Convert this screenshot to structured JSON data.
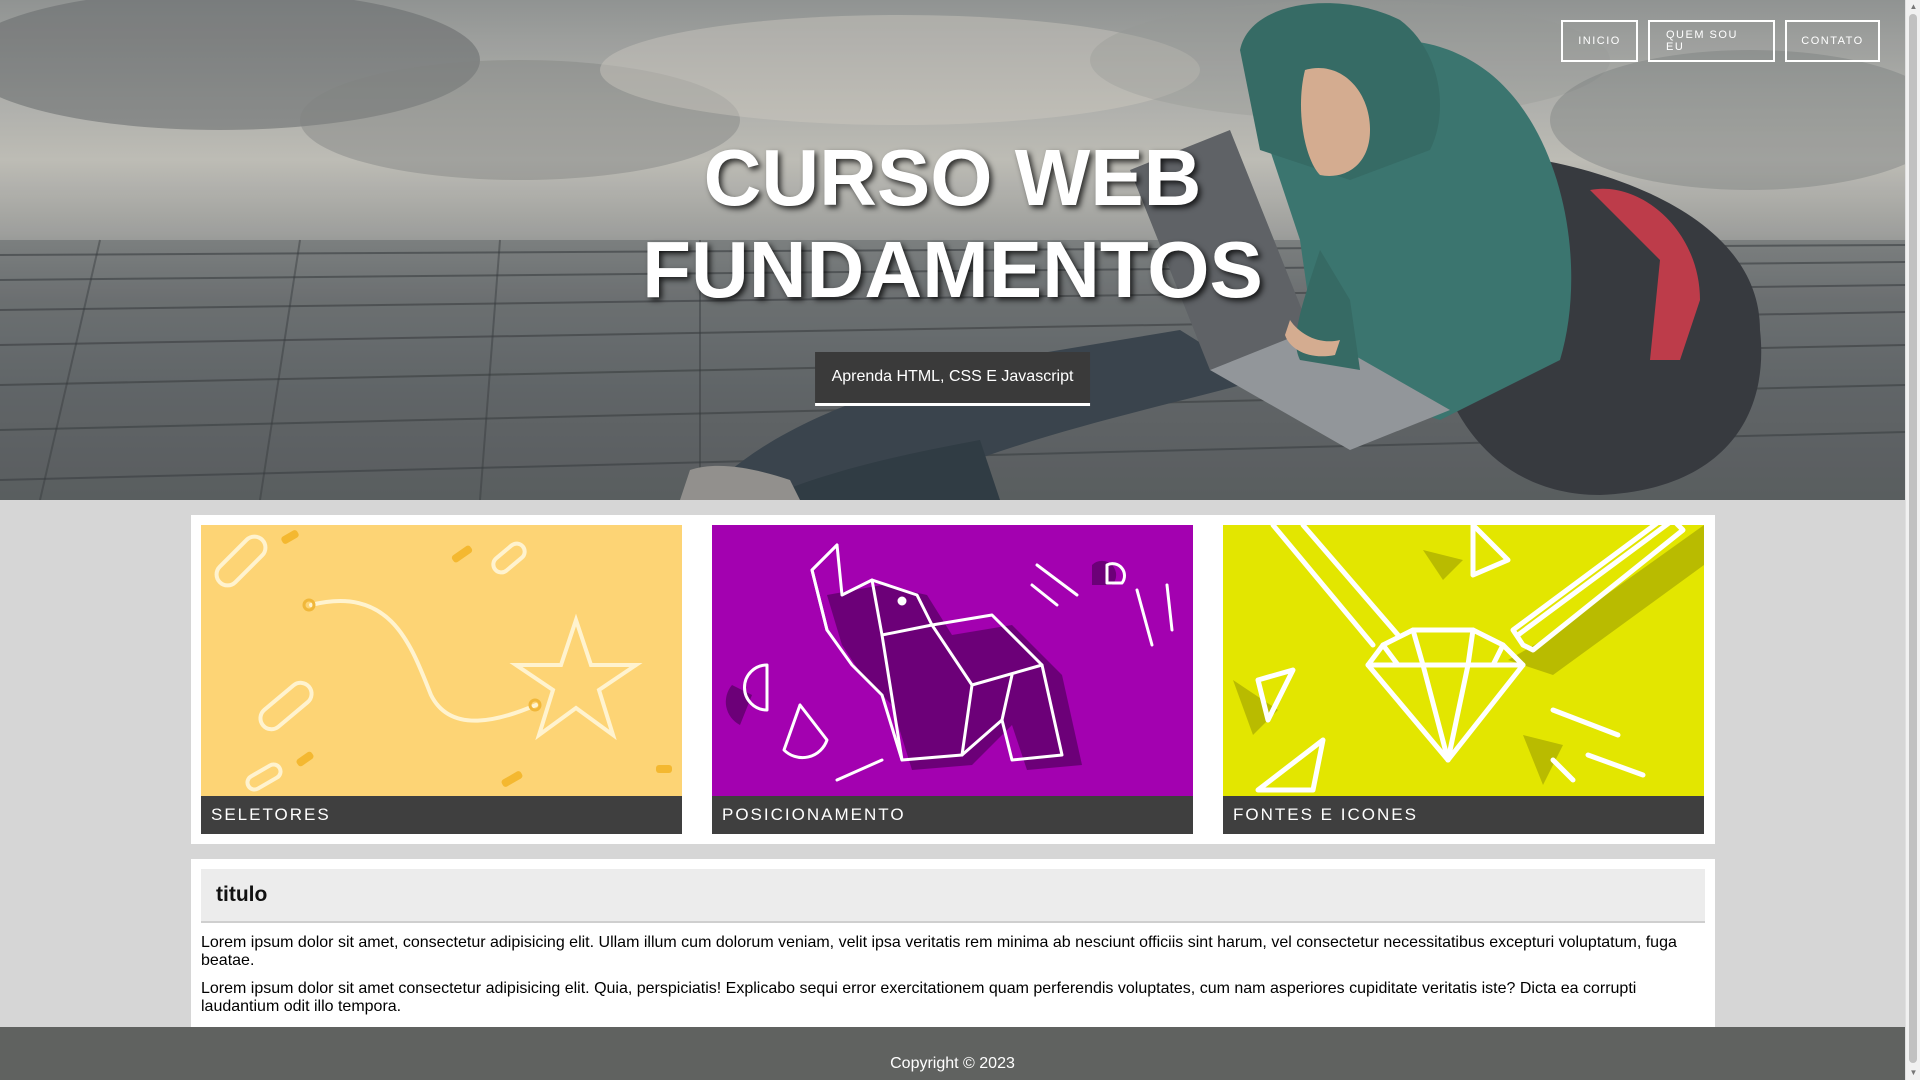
{
  "nav": {
    "items": [
      {
        "label": "INICIO"
      },
      {
        "label": "QUEM SOU EU"
      },
      {
        "label": "CONTATO"
      }
    ]
  },
  "hero": {
    "title_line1": "CURSO WEB",
    "title_line2": "FUNDAMENTOS",
    "subtitle": "Aprenda HTML, CSS E Javascript",
    "image_alt": "person-with-laptop"
  },
  "cards": [
    {
      "label": "SELETORES",
      "color": "#fdd475",
      "icon": "star-path-illustration"
    },
    {
      "label": "POSICIONAMENTO",
      "color": "#a301b0",
      "icon": "origami-elephant-illustration"
    },
    {
      "label": "FONTES E ICONES",
      "color": "#e3e600",
      "icon": "diamond-pencil-illustration"
    }
  ],
  "article": {
    "title": "titulo",
    "paragraph1": "Lorem ipsum dolor sit amet, consectetur adipisicing elit. Ullam illum cum dolorum veniam, velit ipsa veritatis rem minima ab nesciunt officiis sint harum, vel consectetur necessitatibus excepturi voluptatum, fuga beatae.",
    "paragraph2": "Lorem ipsum dolor sit amet consectetur adipisicing elit. Quia, perspiciatis! Explicabo sequi error exercitationem quam perferendis voluptates, cum nam asperiores cupiditate veritatis iste? Dicta ea corrupti laudantium odit illo tempora."
  },
  "footer": {
    "copyright": "Copyright © 2023"
  },
  "colors": {
    "nav_border": "#ffffff",
    "subtitle_bg": "#3a3a3a",
    "card_label_bg": "#3f3f3f",
    "footer_bg": "#606260",
    "page_bg": "#d6d6d6"
  }
}
